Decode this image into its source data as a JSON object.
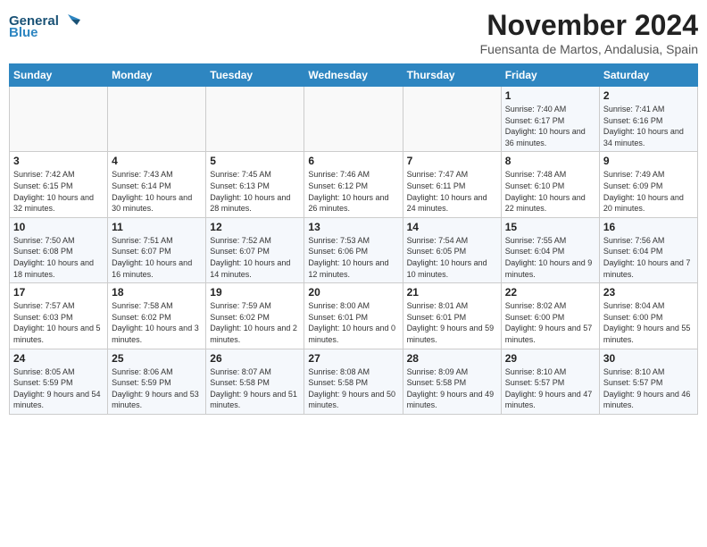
{
  "header": {
    "logo_line1": "General",
    "logo_line2": "Blue",
    "title": "November 2024",
    "subtitle": "Fuensanta de Martos, Andalusia, Spain"
  },
  "days_of_week": [
    "Sunday",
    "Monday",
    "Tuesday",
    "Wednesday",
    "Thursday",
    "Friday",
    "Saturday"
  ],
  "weeks": [
    [
      {
        "day": "",
        "info": ""
      },
      {
        "day": "",
        "info": ""
      },
      {
        "day": "",
        "info": ""
      },
      {
        "day": "",
        "info": ""
      },
      {
        "day": "",
        "info": ""
      },
      {
        "day": "1",
        "info": "Sunrise: 7:40 AM\nSunset: 6:17 PM\nDaylight: 10 hours and 36 minutes."
      },
      {
        "day": "2",
        "info": "Sunrise: 7:41 AM\nSunset: 6:16 PM\nDaylight: 10 hours and 34 minutes."
      }
    ],
    [
      {
        "day": "3",
        "info": "Sunrise: 7:42 AM\nSunset: 6:15 PM\nDaylight: 10 hours and 32 minutes."
      },
      {
        "day": "4",
        "info": "Sunrise: 7:43 AM\nSunset: 6:14 PM\nDaylight: 10 hours and 30 minutes."
      },
      {
        "day": "5",
        "info": "Sunrise: 7:45 AM\nSunset: 6:13 PM\nDaylight: 10 hours and 28 minutes."
      },
      {
        "day": "6",
        "info": "Sunrise: 7:46 AM\nSunset: 6:12 PM\nDaylight: 10 hours and 26 minutes."
      },
      {
        "day": "7",
        "info": "Sunrise: 7:47 AM\nSunset: 6:11 PM\nDaylight: 10 hours and 24 minutes."
      },
      {
        "day": "8",
        "info": "Sunrise: 7:48 AM\nSunset: 6:10 PM\nDaylight: 10 hours and 22 minutes."
      },
      {
        "day": "9",
        "info": "Sunrise: 7:49 AM\nSunset: 6:09 PM\nDaylight: 10 hours and 20 minutes."
      }
    ],
    [
      {
        "day": "10",
        "info": "Sunrise: 7:50 AM\nSunset: 6:08 PM\nDaylight: 10 hours and 18 minutes."
      },
      {
        "day": "11",
        "info": "Sunrise: 7:51 AM\nSunset: 6:07 PM\nDaylight: 10 hours and 16 minutes."
      },
      {
        "day": "12",
        "info": "Sunrise: 7:52 AM\nSunset: 6:07 PM\nDaylight: 10 hours and 14 minutes."
      },
      {
        "day": "13",
        "info": "Sunrise: 7:53 AM\nSunset: 6:06 PM\nDaylight: 10 hours and 12 minutes."
      },
      {
        "day": "14",
        "info": "Sunrise: 7:54 AM\nSunset: 6:05 PM\nDaylight: 10 hours and 10 minutes."
      },
      {
        "day": "15",
        "info": "Sunrise: 7:55 AM\nSunset: 6:04 PM\nDaylight: 10 hours and 9 minutes."
      },
      {
        "day": "16",
        "info": "Sunrise: 7:56 AM\nSunset: 6:04 PM\nDaylight: 10 hours and 7 minutes."
      }
    ],
    [
      {
        "day": "17",
        "info": "Sunrise: 7:57 AM\nSunset: 6:03 PM\nDaylight: 10 hours and 5 minutes."
      },
      {
        "day": "18",
        "info": "Sunrise: 7:58 AM\nSunset: 6:02 PM\nDaylight: 10 hours and 3 minutes."
      },
      {
        "day": "19",
        "info": "Sunrise: 7:59 AM\nSunset: 6:02 PM\nDaylight: 10 hours and 2 minutes."
      },
      {
        "day": "20",
        "info": "Sunrise: 8:00 AM\nSunset: 6:01 PM\nDaylight: 10 hours and 0 minutes."
      },
      {
        "day": "21",
        "info": "Sunrise: 8:01 AM\nSunset: 6:01 PM\nDaylight: 9 hours and 59 minutes."
      },
      {
        "day": "22",
        "info": "Sunrise: 8:02 AM\nSunset: 6:00 PM\nDaylight: 9 hours and 57 minutes."
      },
      {
        "day": "23",
        "info": "Sunrise: 8:04 AM\nSunset: 6:00 PM\nDaylight: 9 hours and 55 minutes."
      }
    ],
    [
      {
        "day": "24",
        "info": "Sunrise: 8:05 AM\nSunset: 5:59 PM\nDaylight: 9 hours and 54 minutes."
      },
      {
        "day": "25",
        "info": "Sunrise: 8:06 AM\nSunset: 5:59 PM\nDaylight: 9 hours and 53 minutes."
      },
      {
        "day": "26",
        "info": "Sunrise: 8:07 AM\nSunset: 5:58 PM\nDaylight: 9 hours and 51 minutes."
      },
      {
        "day": "27",
        "info": "Sunrise: 8:08 AM\nSunset: 5:58 PM\nDaylight: 9 hours and 50 minutes."
      },
      {
        "day": "28",
        "info": "Sunrise: 8:09 AM\nSunset: 5:58 PM\nDaylight: 9 hours and 49 minutes."
      },
      {
        "day": "29",
        "info": "Sunrise: 8:10 AM\nSunset: 5:57 PM\nDaylight: 9 hours and 47 minutes."
      },
      {
        "day": "30",
        "info": "Sunrise: 8:10 AM\nSunset: 5:57 PM\nDaylight: 9 hours and 46 minutes."
      }
    ]
  ]
}
